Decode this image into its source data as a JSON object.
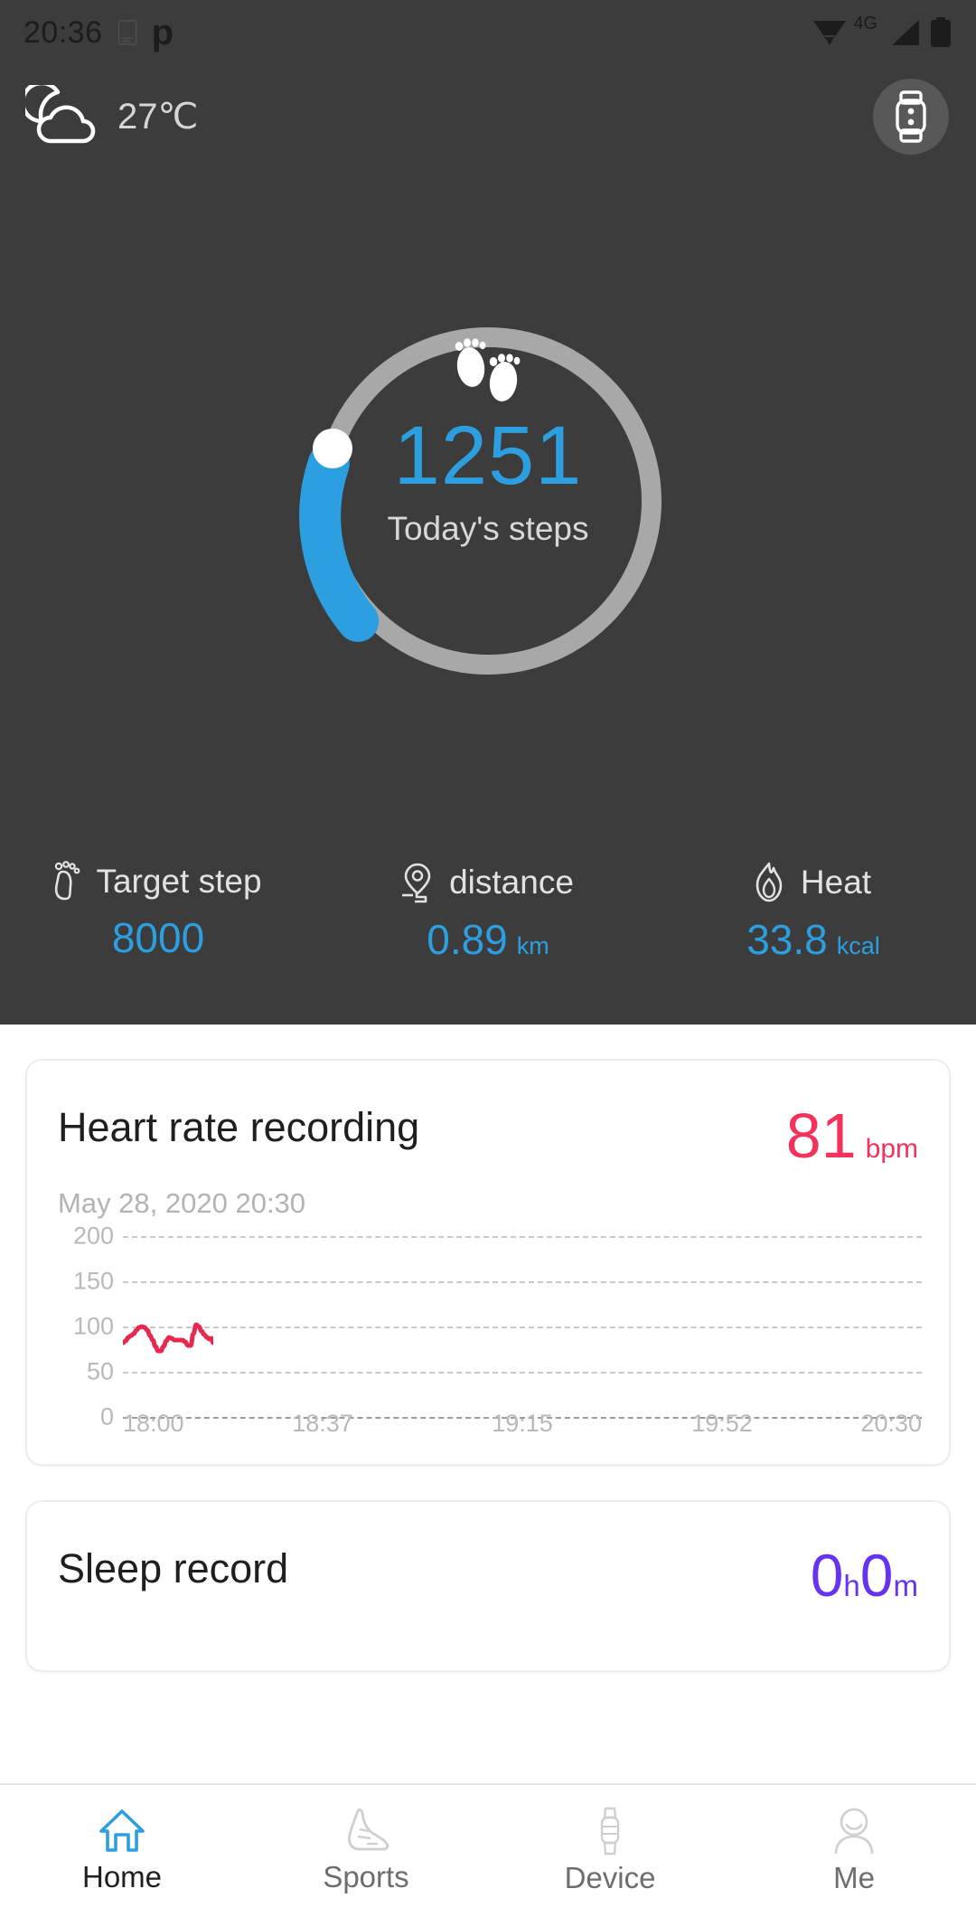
{
  "statusbar": {
    "time": "20:36",
    "network_label": "4G",
    "icons": [
      "notification-icon",
      "pushbullet-icon",
      "wifi-icon",
      "signal-icon",
      "battery-icon"
    ]
  },
  "header": {
    "weather": {
      "icon": "night-cloudy-icon",
      "temperature": "27℃"
    },
    "device_button": {
      "icon": "fitness-band-icon",
      "label": ""
    }
  },
  "steps": {
    "icon": "footprints-icon",
    "value": "1251",
    "label": "Today's steps",
    "goal": 8000,
    "progress_percent": 15.6,
    "ring_color": "#2b9fe0",
    "track_color": "#a8a8a8"
  },
  "stats": [
    {
      "icon": "footprint-icon",
      "name": "Target step",
      "value": "8000",
      "unit": ""
    },
    {
      "icon": "location-pin-icon",
      "name": "distance",
      "value": "0.89",
      "unit": "km"
    },
    {
      "icon": "flame-icon",
      "name": "Heat",
      "value": "33.8",
      "unit": "kcal"
    }
  ],
  "heart_rate_card": {
    "title": "Heart rate recording",
    "value": "81",
    "unit": "bpm",
    "timestamp": "May 28, 2020 20:30",
    "color": "#f5325b"
  },
  "sleep_card": {
    "title": "Sleep record",
    "hours": "0",
    "hours_unit": "h",
    "minutes": "0",
    "minutes_unit": "m",
    "color": "#6633ee"
  },
  "bottom_nav": [
    {
      "icon": "home-icon",
      "label": "Home",
      "active": true
    },
    {
      "icon": "shoe-icon",
      "label": "Sports",
      "active": false
    },
    {
      "icon": "band-icon",
      "label": "Device",
      "active": false
    },
    {
      "icon": "person-icon",
      "label": "Me",
      "active": false
    }
  ],
  "chart_data": {
    "type": "line",
    "title": "Heart rate recording",
    "xlabel": "",
    "ylabel": "",
    "ylim": [
      0,
      200
    ],
    "yticks": [
      0,
      50,
      100,
      150,
      200
    ],
    "xticks": [
      "18:00",
      "18:37",
      "19:15",
      "19:52",
      "20:30"
    ],
    "grid": true,
    "legend": "none",
    "line_color": "#e8294f",
    "x": [
      0,
      4,
      8,
      12,
      16,
      20,
      24,
      28,
      32,
      36,
      40,
      44,
      48,
      52,
      56,
      60,
      64,
      68,
      72,
      76,
      80,
      84,
      88,
      92,
      96,
      100
    ],
    "values": [
      82,
      84,
      88,
      90,
      91,
      93,
      99,
      100,
      99,
      97,
      90,
      86,
      78,
      72,
      73,
      80,
      85,
      88,
      87,
      85,
      85,
      85,
      84,
      80,
      78,
      79
    ],
    "values_tail": [
      95,
      102,
      101,
      96,
      92,
      90,
      88,
      85,
      84,
      86,
      87,
      85,
      82
    ],
    "series": [
      {
        "name": "Heart rate",
        "points": [
          [
            0,
            82
          ],
          [
            3,
            84
          ],
          [
            6,
            88
          ],
          [
            9,
            90
          ],
          [
            12,
            92
          ],
          [
            15,
            96
          ],
          [
            18,
            99
          ],
          [
            21,
            100
          ],
          [
            24,
            99
          ],
          [
            27,
            96
          ],
          [
            30,
            90
          ],
          [
            33,
            85
          ],
          [
            36,
            78
          ],
          [
            39,
            73
          ],
          [
            42,
            73
          ],
          [
            45,
            78
          ],
          [
            48,
            84
          ],
          [
            51,
            88
          ],
          [
            54,
            87
          ],
          [
            57,
            85
          ],
          [
            60,
            85
          ],
          [
            63,
            85
          ],
          [
            66,
            85
          ],
          [
            69,
            83
          ],
          [
            72,
            79
          ],
          [
            75,
            79
          ],
          [
            78,
            92
          ],
          [
            81,
            102
          ],
          [
            84,
            100
          ],
          [
            87,
            95
          ],
          [
            90,
            91
          ],
          [
            93,
            88
          ],
          [
            96,
            86
          ],
          [
            98,
            87
          ],
          [
            100,
            82
          ]
        ]
      }
    ]
  }
}
